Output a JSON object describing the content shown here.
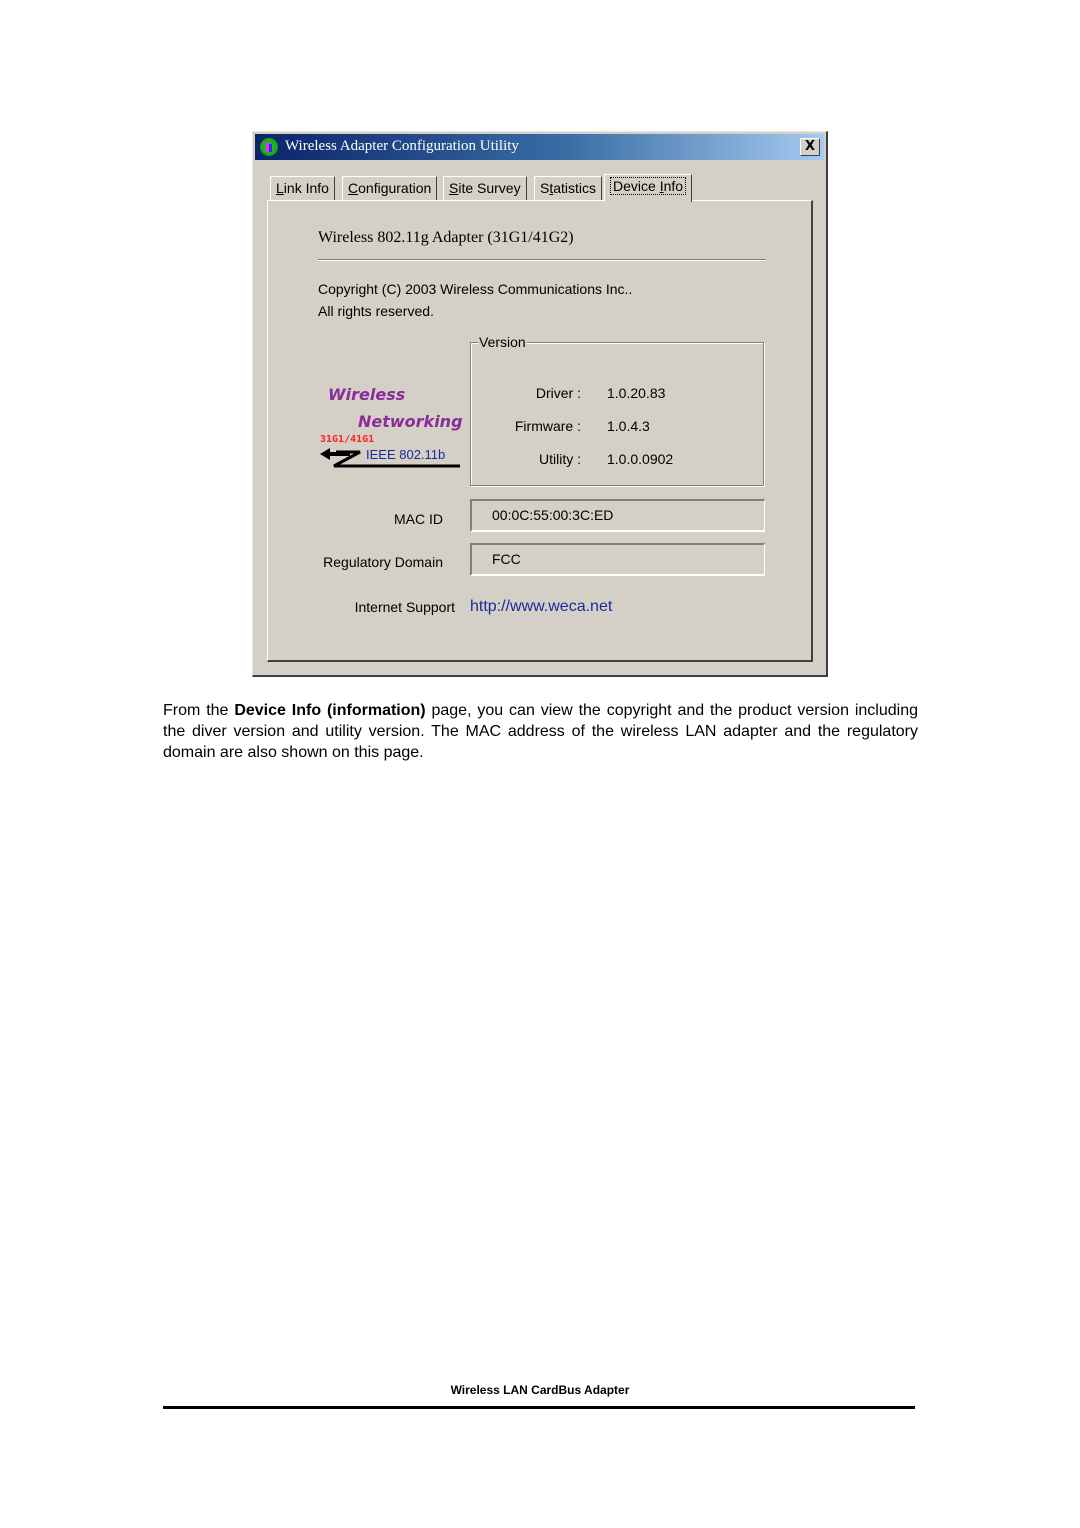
{
  "window": {
    "title": "Wireless Adapter Configuration Utility",
    "close_label": "X",
    "app_icon": "wireless-utility-app-icon"
  },
  "tabs": [
    {
      "label_pre": "",
      "mnemonic": "L",
      "label_post": "ink Info",
      "active": false
    },
    {
      "label_pre": "",
      "mnemonic": "C",
      "label_post": "onfiguration",
      "active": false
    },
    {
      "label_pre": "",
      "mnemonic": "S",
      "label_post": "ite Survey",
      "active": false
    },
    {
      "label_pre": "S",
      "mnemonic": "t",
      "label_post": "atistics",
      "active": false
    },
    {
      "label_pre": "Device ",
      "mnemonic": "I",
      "label_post": "nfo",
      "active": true
    }
  ],
  "device_info": {
    "heading": "Wireless 802.11g Adapter (31G1/41G2)",
    "copyright_line1": "Copyright (C) 2003 Wireless Communications Inc..",
    "copyright_line2": "All rights reserved.",
    "logo": {
      "line1": "Wireless",
      "line2": "Networking",
      "model": "31G1/41G1",
      "standard": "IEEE 802.11b"
    },
    "version": {
      "legend": "Version",
      "rows": [
        {
          "label": "Driver :",
          "value": "1.0.20.83"
        },
        {
          "label": "Firmware :",
          "value": "1.0.4.3"
        },
        {
          "label": "Utility :",
          "value": "1.0.0.0902"
        }
      ]
    },
    "mac_id": {
      "label": "MAC ID",
      "value": "00:0C:55:00:3C:ED"
    },
    "regulatory_domain": {
      "label": "Regulatory Domain",
      "value": "FCC"
    },
    "internet_support": {
      "label": "Internet Support",
      "value": "http://www.weca.net"
    }
  },
  "document": {
    "para_pre": "From the ",
    "para_bold": "Device Info (information)",
    "para_post": " page, you can view the copyright and the product version including the diver version and utility version. The MAC address of the wireless LAN adapter and the regulatory domain are also shown on this page.",
    "footer": "Wireless LAN CardBus Adapter"
  }
}
